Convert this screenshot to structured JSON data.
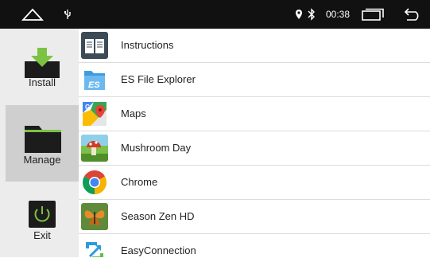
{
  "status_bar": {
    "time": "00:38",
    "icons": [
      "home-icon",
      "usb-icon",
      "location-icon",
      "bluetooth-icon",
      "recent-apps-icon",
      "back-icon"
    ]
  },
  "sidebar": {
    "items": [
      {
        "label": "Install",
        "icon": "install-icon",
        "active": false
      },
      {
        "label": "Manage",
        "icon": "folder-icon",
        "active": true
      },
      {
        "label": "Exit",
        "icon": "power-icon",
        "active": false
      }
    ]
  },
  "apps": [
    {
      "name": "Instructions",
      "icon": "book-icon"
    },
    {
      "name": "ES File Explorer",
      "icon": "es-file-explorer-icon"
    },
    {
      "name": "Maps",
      "icon": "maps-icon"
    },
    {
      "name": "Mushroom Day",
      "icon": "mushroom-day-icon"
    },
    {
      "name": "Chrome",
      "icon": "chrome-icon"
    },
    {
      "name": "Season Zen HD",
      "icon": "butterfly-icon"
    },
    {
      "name": "EasyConnection",
      "icon": "easyconnection-icon"
    }
  ],
  "colors": {
    "status_bar": "#111111",
    "sidebar": "#ececec",
    "sidebar_active": "#cfcfcf",
    "install_arrow": "#7cc243"
  }
}
